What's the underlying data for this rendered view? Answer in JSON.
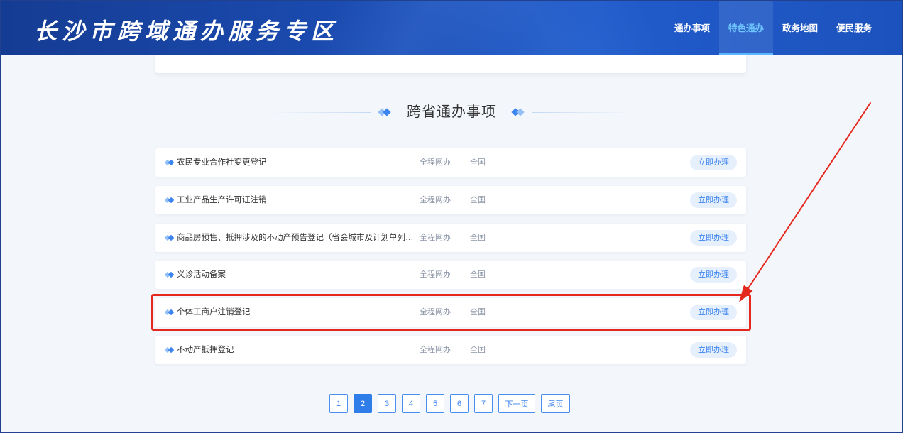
{
  "header": {
    "title": "长沙市跨域通办服务专区",
    "nav": [
      {
        "label": "通办事项",
        "active": false
      },
      {
        "label": "特色通办",
        "active": true
      },
      {
        "label": "政务地图",
        "active": false
      },
      {
        "label": "便民服务",
        "active": false
      }
    ]
  },
  "section": {
    "title": "跨省通办事项"
  },
  "items": [
    {
      "name": "农民专业合作社变更登记",
      "mode": "全程网办",
      "scope": "全国",
      "action": "立即办理",
      "highlighted": false
    },
    {
      "name": "工业产品生产许可证注销",
      "mode": "全程网办",
      "scope": "全国",
      "action": "立即办理",
      "highlighted": false
    },
    {
      "name": "商品房预售、抵押涉及的不动产预告登记（省会城市及计划单列…",
      "mode": "全程网办",
      "scope": "全国",
      "action": "立即办理",
      "highlighted": false
    },
    {
      "name": "义诊活动备案",
      "mode": "全程网办",
      "scope": "全国",
      "action": "立即办理",
      "highlighted": false
    },
    {
      "name": "个体工商户注销登记",
      "mode": "全程网办",
      "scope": "全国",
      "action": "立即办理",
      "highlighted": true
    },
    {
      "name": "不动产抵押登记",
      "mode": "全程网办",
      "scope": "全国",
      "action": "立即办理",
      "highlighted": false
    }
  ],
  "pagination": {
    "pages": [
      "1",
      "2",
      "3",
      "4",
      "5",
      "6",
      "7"
    ],
    "current": "2",
    "next_label": "下一页",
    "last_label": "尾页"
  },
  "icons": {
    "section_marker": "diamond-pair-icon",
    "row_marker": "diamond-pair-icon",
    "annotation": "arrow-icon"
  },
  "colors": {
    "accent": "#3d85ee",
    "active_nav_text": "#6fc6ff",
    "page_bg": "#f3f6fa",
    "button_bg": "#e6f0fd",
    "annotation": "#e5281e",
    "frame": "#21418f"
  }
}
